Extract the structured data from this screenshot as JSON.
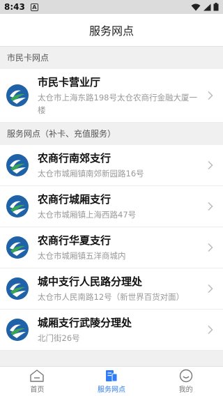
{
  "status_bar": {
    "time": "8:43",
    "notification_letter": "A"
  },
  "header": {
    "title": "服务网点"
  },
  "sections": [
    {
      "title": "市民卡网点",
      "items": [
        {
          "name": "市民卡营业厅",
          "address": "太仓市上海东路198号太仓农商行金融大厦一楼"
        }
      ]
    },
    {
      "title": "服务网点（补卡、充值服务）",
      "items": [
        {
          "name": "农商行南郊支行",
          "address": "太仓市城厢镇南郊新园路16号"
        },
        {
          "name": "农商行城厢支行",
          "address": "太仓市城厢镇上海西路47号"
        },
        {
          "name": "农商行华夏支行",
          "address": "太仓市城厢镇五洋商城内"
        },
        {
          "name": "城中支行人民路分理处",
          "address": "太仓市人民南路12号（新世界百货对面）"
        },
        {
          "name": "城厢支行武陵分理处",
          "address": "北门街26号"
        }
      ]
    }
  ],
  "tab_bar": {
    "tabs": [
      {
        "label": "首页",
        "icon": "home-icon",
        "active": false
      },
      {
        "label": "服务网点",
        "icon": "service-points-icon",
        "active": true
      },
      {
        "label": "我的",
        "icon": "smiley-profile-icon",
        "active": false
      }
    ]
  },
  "colors": {
    "accent": "#2e7cf6",
    "logo_green": "#3aa655",
    "logo_blue": "#1f62a8"
  }
}
